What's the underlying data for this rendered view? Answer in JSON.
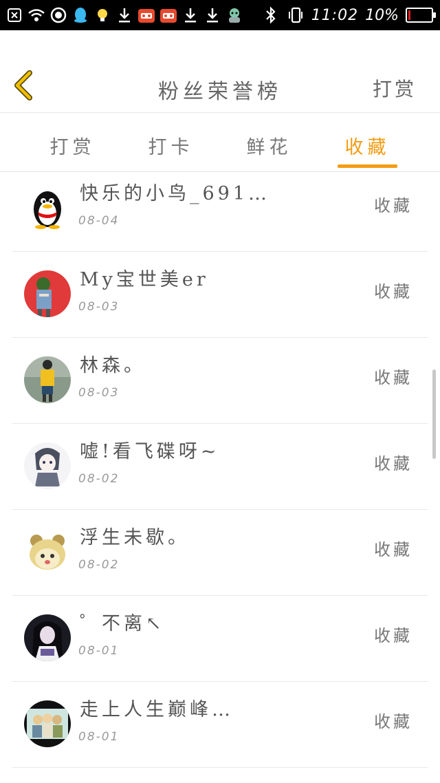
{
  "status_bar": {
    "time": "11:02",
    "battery_text": "10%",
    "battery_level": 0.1,
    "icons": [
      "close-box-icon",
      "wifi-icon",
      "target-icon",
      "qq-icon",
      "bulb-icon",
      "download-icon",
      "app-icon",
      "app-icon",
      "download-icon",
      "download-icon",
      "robot-icon"
    ],
    "right_icons": [
      "bluetooth-icon",
      "vibrate-icon"
    ]
  },
  "header": {
    "title": "粉丝荣誉榜",
    "right_label": "打赏"
  },
  "tabs": [
    {
      "label": "打赏",
      "active": false
    },
    {
      "label": "打卡",
      "active": false
    },
    {
      "label": "鲜花",
      "active": false
    },
    {
      "label": "收藏",
      "active": true
    }
  ],
  "list": [
    {
      "name": "快乐的小鸟_691…",
      "date": "08-04",
      "action": "收藏",
      "avatar": "penguin"
    },
    {
      "name": "My宝世美er",
      "date": "08-03",
      "action": "收藏",
      "avatar": "red"
    },
    {
      "name": "林森。",
      "date": "08-03",
      "action": "收藏",
      "avatar": "yellow-shirt"
    },
    {
      "name": "嘘!看飞碟呀~",
      "date": "08-02",
      "action": "收藏",
      "avatar": "anime"
    },
    {
      "name": "浮生未歇。",
      "date": "08-02",
      "action": "收藏",
      "avatar": "bear"
    },
    {
      "name": "゜不离↖",
      "date": "08-01",
      "action": "收藏",
      "avatar": "girl-dark"
    },
    {
      "name": "走上人生巅峰…",
      "date": "08-01",
      "action": "收藏",
      "avatar": "group-photo"
    }
  ],
  "colors": {
    "accent": "#f39c12",
    "back_arrow": "#f0b400",
    "status_bar_bg": "#000000"
  }
}
